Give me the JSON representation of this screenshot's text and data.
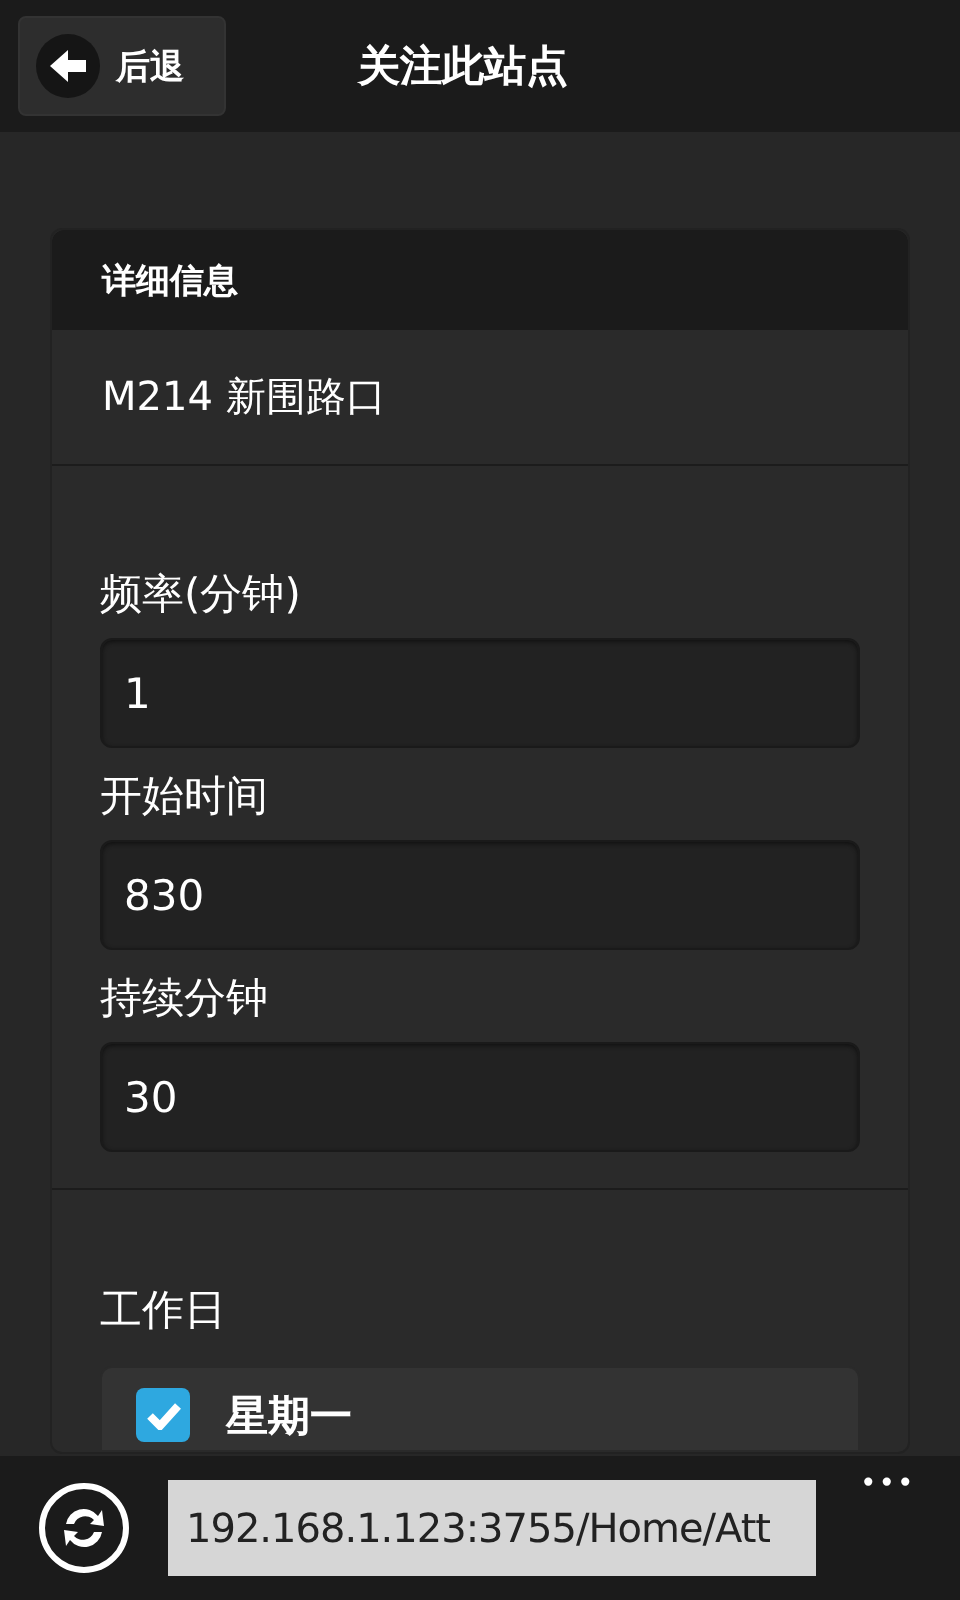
{
  "header": {
    "back_label": "后退",
    "title": "关注此站点"
  },
  "card": {
    "title": "详细信息",
    "station": "M214 新围路口",
    "fields": [
      {
        "label": "频率(分钟)",
        "value": "1"
      },
      {
        "label": "开始时间",
        "value": "830"
      },
      {
        "label": "持续分钟",
        "value": "30"
      }
    ],
    "workdays_label": "工作日",
    "workdays": [
      {
        "label": "星期一",
        "checked": true
      }
    ]
  },
  "address_bar": {
    "url": "192.168.1.123:3755/Home/Att",
    "menu": "•••"
  }
}
